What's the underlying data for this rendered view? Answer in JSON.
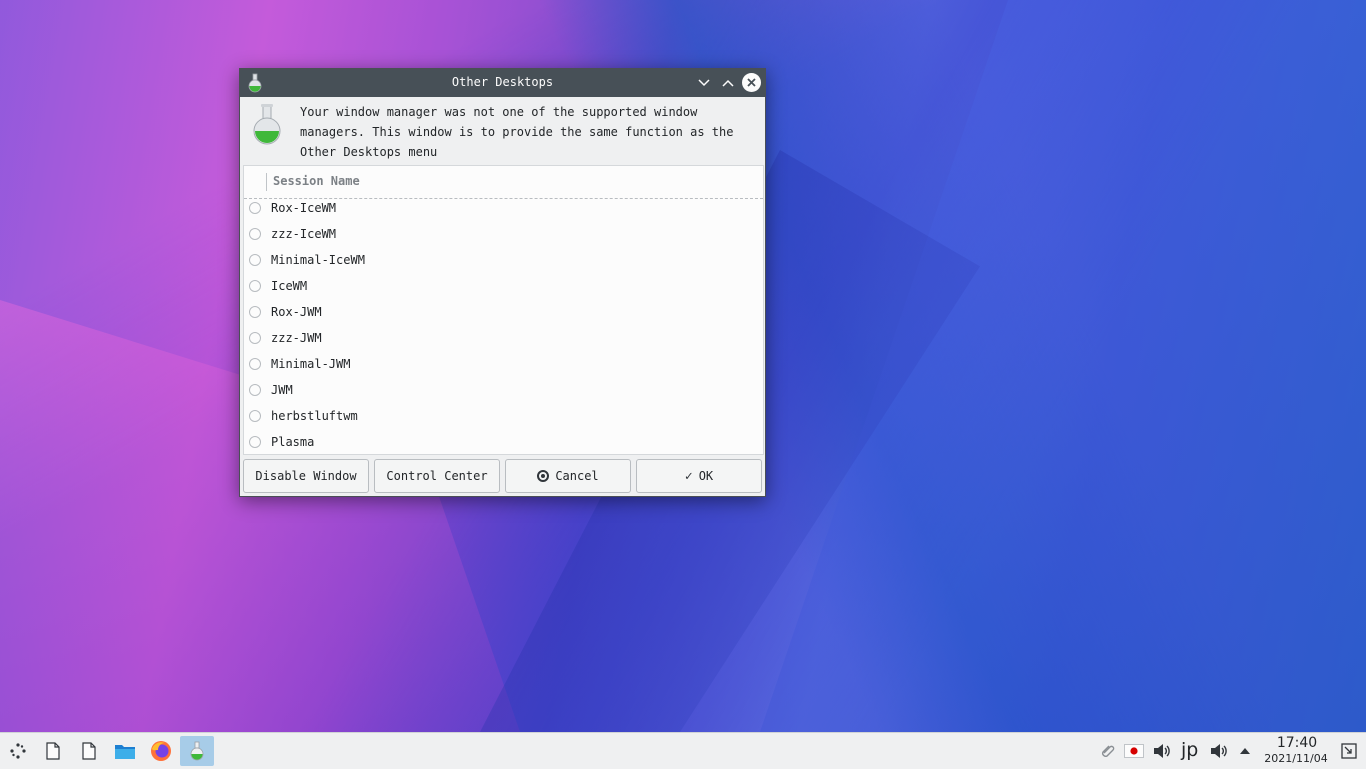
{
  "window": {
    "title": "Other Desktops",
    "message": "Your window manager was not one of the supported window managers. This window is to provide the same function as the Other Desktops menu",
    "list_header": "Session Name",
    "sessions": [
      "Rox-IceWM",
      "zzz-IceWM",
      "Minimal-IceWM",
      "IceWM",
      "Rox-JWM",
      "zzz-JWM",
      "Minimal-JWM",
      "JWM",
      "herbstluftwm",
      "Plasma"
    ],
    "buttons": {
      "disable": "Disable Window",
      "control_center": "Control Center",
      "cancel": "Cancel",
      "ok": "OK"
    }
  },
  "taskbar": {
    "keyboard_layout": "jp",
    "time": "17:40",
    "date": "2021/11/04"
  },
  "colors": {
    "titlebar": "#475057",
    "flask_liquid": "#3fb83a",
    "taskbar_active": "#a7cce8"
  }
}
